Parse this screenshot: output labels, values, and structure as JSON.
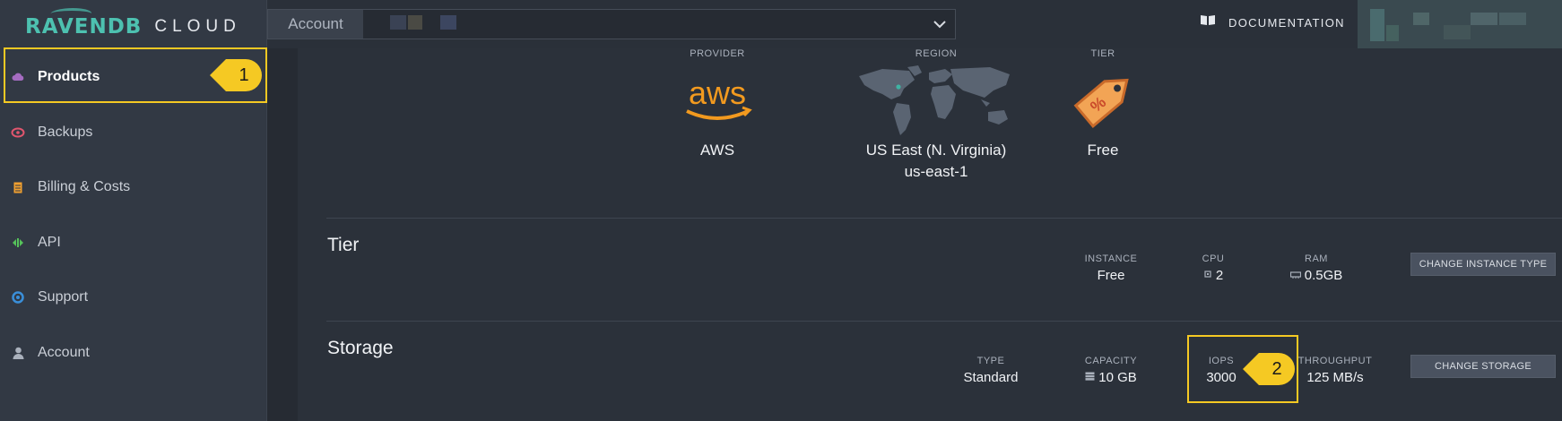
{
  "app": {
    "logo_main": "RAVENDB",
    "logo_sub": "CLOUD"
  },
  "sidebar": {
    "items": [
      {
        "label": "Products",
        "icon": "cloud-icon",
        "color": "#a56cc1"
      },
      {
        "label": "Backups",
        "icon": "backup-icon",
        "color": "#e2566e"
      },
      {
        "label": "Billing & Costs",
        "icon": "billing-icon",
        "color": "#f0a030"
      },
      {
        "label": "API",
        "icon": "api-icon",
        "color": "#55c25a"
      },
      {
        "label": "Support",
        "icon": "support-icon",
        "color": "#3a8fd9"
      },
      {
        "label": "Account",
        "icon": "user-icon",
        "color": "#aab1bc"
      }
    ]
  },
  "topbar": {
    "account_label": "Account",
    "documentation": "DOCUMENTATION"
  },
  "overview": {
    "provider_label": "PROVIDER",
    "provider_value": "AWS",
    "provider_logo": "aws",
    "region_label": "REGION",
    "region_value": "US East (N. Virginia)",
    "region_code": "us-east-1",
    "tier_label": "TIER",
    "tier_value": "Free"
  },
  "tier_section": {
    "title": "Tier",
    "instance_label": "INSTANCE",
    "instance_value": "Free",
    "cpu_label": "CPU",
    "cpu_value": "2",
    "ram_label": "RAM",
    "ram_value": "0.5GB",
    "button": "CHANGE INSTANCE TYPE"
  },
  "storage_section": {
    "title": "Storage",
    "type_label": "TYPE",
    "type_value": "Standard",
    "capacity_label": "CAPACITY",
    "capacity_value": "10 GB",
    "iops_label": "IOPS",
    "iops_value": "3000",
    "throughput_label": "THROUGHPUT",
    "throughput_value": "125 MB/s",
    "button": "CHANGE STORAGE"
  },
  "callouts": [
    "1",
    "2"
  ],
  "colors": {
    "accent_teal": "#4dc1b0",
    "highlight_yellow": "#f5c923",
    "aws_orange": "#f29a1f"
  }
}
